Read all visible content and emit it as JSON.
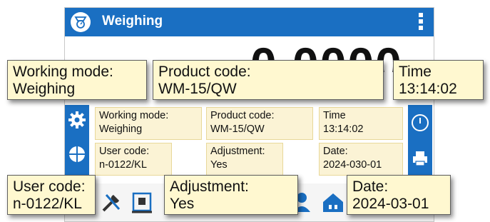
{
  "header": {
    "title": "Weighing",
    "app_icon": "scale-icon",
    "menu_icon": "vertical-dots-menu-icon",
    "color": "#1a6fc2"
  },
  "reading": {
    "value": "0.0000"
  },
  "info_panel": {
    "working_mode": {
      "label": "Working mode:",
      "value": "Weighing"
    },
    "product_code": {
      "label": "Product code:",
      "value": "WM-15/QW"
    },
    "time": {
      "label": "Time",
      "value": "13:14:02"
    },
    "user_code": {
      "label": "User code:",
      "value": "n-0122/KL"
    },
    "adjustment": {
      "label": "Adjustment:",
      "value": "Yes"
    },
    "date": {
      "label": "Date:",
      "value": "2024-030-01"
    }
  },
  "side_buttons": {
    "left": [
      "gear-icon",
      "level-icon"
    ],
    "right": [
      "power-icon",
      "printer-icon"
    ]
  },
  "bottom_icons": [
    "tools-icon",
    "tare-icon",
    "user-icon",
    "home-icon"
  ],
  "callouts": {
    "working_mode": {
      "label": "Working mode:",
      "value": "Weighing"
    },
    "product_code": {
      "label": "Product code:",
      "value": "WM-15/QW"
    },
    "time": {
      "label": "Time",
      "value": "13:14:02"
    },
    "user_code": {
      "label": "User code:",
      "value": "n-0122/KL"
    },
    "adjustment": {
      "label": "Adjustment:",
      "value": "Yes"
    },
    "date": {
      "label": "Date:",
      "value": "2024-03-01"
    }
  }
}
